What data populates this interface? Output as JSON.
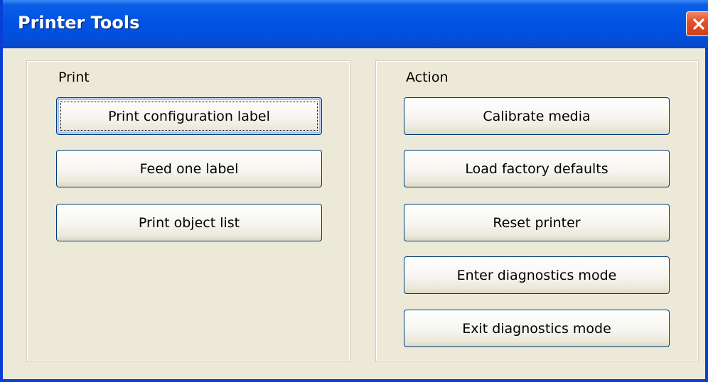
{
  "window": {
    "title": "Printer Tools",
    "close_icon": "close-x-icon"
  },
  "print_group": {
    "label": "Print",
    "buttons": [
      {
        "label": "Print configuration label"
      },
      {
        "label": "Feed one label"
      },
      {
        "label": "Print object list"
      }
    ]
  },
  "action_group": {
    "label": "Action",
    "buttons": [
      {
        "label": "Calibrate media"
      },
      {
        "label": "Load factory defaults"
      },
      {
        "label": "Reset printer"
      },
      {
        "label": "Enter diagnostics mode"
      },
      {
        "label": "Exit diagnostics mode"
      }
    ]
  },
  "colors": {
    "titlebar": "#0054e3",
    "face": "#ece9d8",
    "close_button": "#e2512a",
    "button_border": "#003c74"
  }
}
